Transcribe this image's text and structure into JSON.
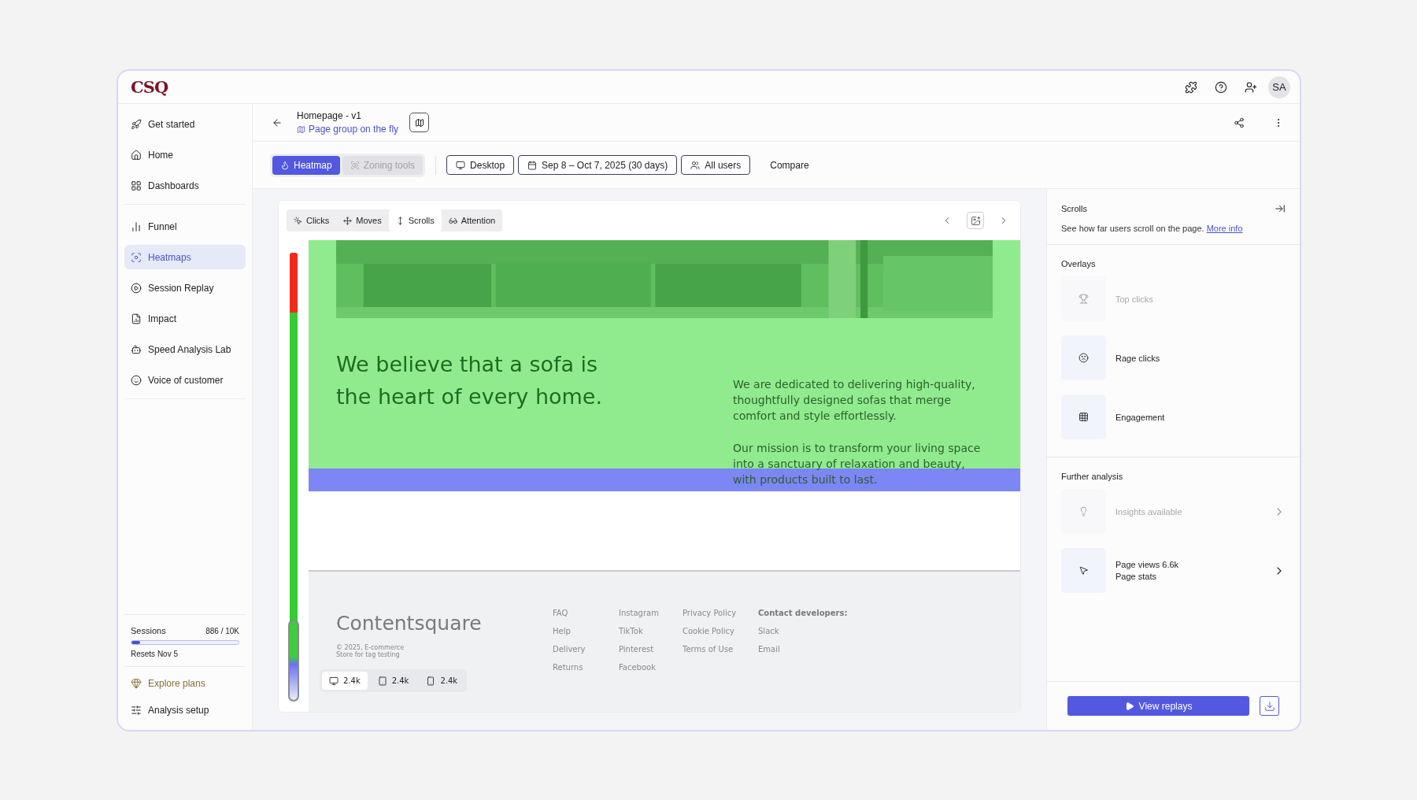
{
  "logo": "CSQ",
  "avatar": "SA",
  "sidebar": {
    "groups": [
      [
        {
          "label": "Get started",
          "selected": false
        },
        {
          "label": "Home",
          "selected": false
        },
        {
          "label": "Dashboards",
          "selected": false
        }
      ],
      [
        {
          "label": "Funnel",
          "selected": false
        },
        {
          "label": "Heatmaps",
          "selected": true
        },
        {
          "label": "Session Replay",
          "selected": false
        },
        {
          "label": "Impact",
          "selected": false
        },
        {
          "label": "Speed Analysis Lab",
          "selected": false
        },
        {
          "label": "Voice of customer",
          "selected": false
        }
      ]
    ],
    "sessions": {
      "label": "Sessions",
      "count": "886 / 10K",
      "level": 0.08,
      "note": "Resets Nov 5"
    },
    "footer_links": [
      {
        "label": "Explore plans",
        "kind": "upgrade"
      },
      {
        "label": "Analysis setup",
        "kind": "plain"
      }
    ]
  },
  "header": {
    "title": "Homepage - v1",
    "subtitle": "Page group on the fly"
  },
  "modes": [
    {
      "label": "Heatmap",
      "selected": true
    },
    {
      "label": "Zoning tools",
      "selected": false
    }
  ],
  "filters": [
    "Desktop",
    "Sep 8 – Oct 7, 2025 (30 days)",
    "All users"
  ],
  "compare": "Compare",
  "heatmap_tabs": [
    {
      "label": "Clicks",
      "selected": false
    },
    {
      "label": "Moves",
      "selected": false
    },
    {
      "label": "Scrolls",
      "selected": true
    },
    {
      "label": "Attention",
      "selected": false
    }
  ],
  "preview": {
    "headline": "We believe that a sofa is the heart of every home.",
    "paragraphs": [
      "We are dedicated to delivering high-quality, thoughtfully designed sofas that merge comfort and style effortlessly.",
      "Our mission is to transform your living space into a sanctuary of relaxation and beauty, with products built to last."
    ],
    "brand": "Contentsquare",
    "copyright": [
      "© 2025, E-commerce",
      "Store for tag testing"
    ],
    "link_columns": [
      [
        "FAQ",
        "Help",
        "Delivery",
        "Returns"
      ],
      [
        "Instagram",
        "TikTok",
        "Pinterest",
        "Facebook"
      ],
      [
        "Privacy Policy",
        "Cookie Policy",
        "Terms of Use"
      ]
    ],
    "contact": {
      "heading": "Contact developers:",
      "links": [
        "Slack",
        "Email"
      ]
    },
    "devices": [
      {
        "count": "2.4k",
        "selected": true
      },
      {
        "count": "2.4k",
        "selected": false
      },
      {
        "count": "2.4k",
        "selected": false
      }
    ]
  },
  "panel": {
    "title": "Scrolls",
    "description": "See how far users scroll on the page.",
    "link": "More info",
    "overlays_title": "Overlays",
    "overlays": [
      {
        "label": "Top clicks",
        "disabled": true
      },
      {
        "label": "Rage clicks",
        "disabled": false
      },
      {
        "label": "Engagement",
        "disabled": false
      }
    ],
    "further_title": "Further analysis",
    "further": [
      {
        "lines": [
          "Insights available"
        ],
        "disabled": true
      },
      {
        "lines": [
          "Page views 6.6k",
          "Page stats"
        ],
        "disabled": false
      }
    ],
    "button": "View replays"
  }
}
